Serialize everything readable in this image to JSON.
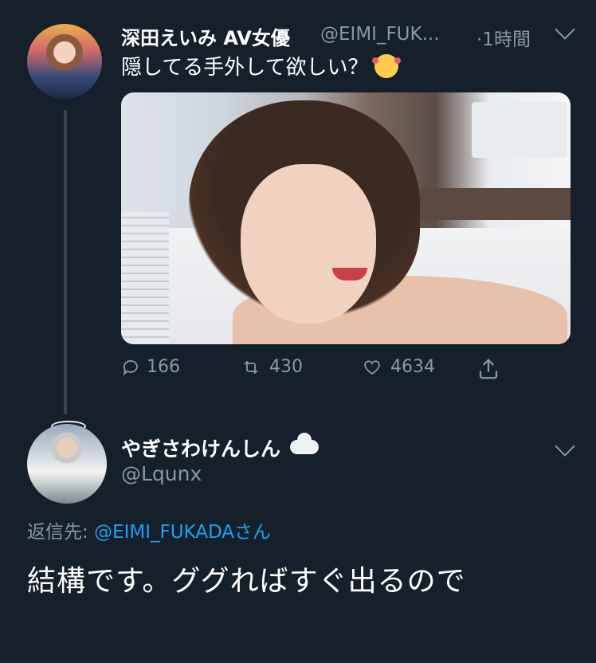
{
  "tweet1": {
    "author_name": "深田えいみ AV女優",
    "handle": "@EIMI_FUK...",
    "time": "·1時間",
    "text": "隠してる手外して欲しい？",
    "emoji_icon": "smiling-face-with-hearts",
    "stats": {
      "replies": "166",
      "retweets": "430",
      "likes": "4634"
    }
  },
  "tweet2": {
    "author_name": "やぎさわけんしん",
    "name_emoji_icon": "cloud",
    "handle": "@Lqunx",
    "reply_label": "返信先: ",
    "reply_mention": "@EIMI_FUKADA",
    "reply_suffix": "さん",
    "text": "結構です。ググればすぐ出るので"
  },
  "colors": {
    "background": "#15202b",
    "secondary_text": "#8899a6",
    "link": "#1da1f2"
  }
}
